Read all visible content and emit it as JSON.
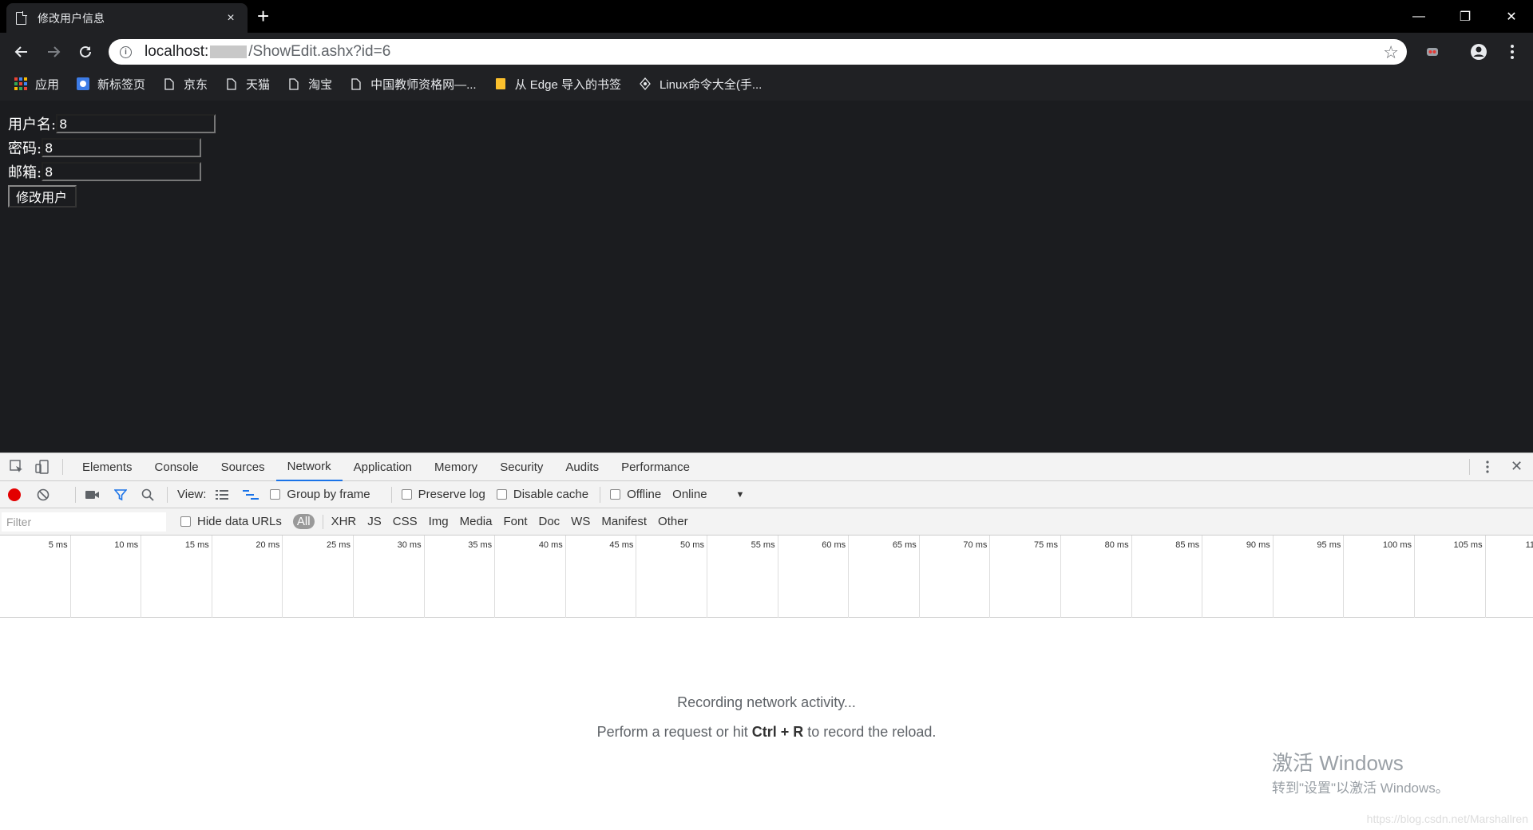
{
  "tab": {
    "title": "修改用户信息",
    "close_label": "×",
    "new_tab_label": "+"
  },
  "window": {
    "minimize": "—",
    "restore": "❐",
    "close": "✕"
  },
  "omnibox": {
    "host": "localhost:",
    "path": "/ShowEdit.ashx?id=6"
  },
  "bookmarks": [
    {
      "label": "应用",
      "icon": "apps-grid-icon"
    },
    {
      "label": "新标签页",
      "icon": "newtab-icon"
    },
    {
      "label": "京东",
      "icon": "page-icon"
    },
    {
      "label": "天猫",
      "icon": "page-icon"
    },
    {
      "label": "淘宝",
      "icon": "page-icon"
    },
    {
      "label": "中国教师资格网—...",
      "icon": "page-icon"
    },
    {
      "label": "从 Edge 导入的书签",
      "icon": "folder-icon"
    },
    {
      "label": "Linux命令大全(手...",
      "icon": "linux-icon"
    }
  ],
  "form": {
    "username_label": "用户名:",
    "username_value": "8",
    "password_label": "密码:",
    "password_value": "8",
    "email_label": "邮箱:",
    "email_value": "8",
    "submit_label": "修改用户"
  },
  "devtools": {
    "tabs": [
      "Elements",
      "Console",
      "Sources",
      "Network",
      "Application",
      "Memory",
      "Security",
      "Audits",
      "Performance"
    ],
    "active_tab": "Network",
    "controls": {
      "view_label": "View:",
      "group_by_frame": "Group by frame",
      "preserve_log": "Preserve log",
      "disable_cache": "Disable cache",
      "offline": "Offline",
      "throttle": "Online"
    },
    "filter": {
      "placeholder": "Filter",
      "hide_data_urls": "Hide data URLs",
      "types": [
        "All",
        "XHR",
        "JS",
        "CSS",
        "Img",
        "Media",
        "Font",
        "Doc",
        "WS",
        "Manifest",
        "Other"
      ]
    },
    "timeline_ticks": [
      "5 ms",
      "10 ms",
      "15 ms",
      "20 ms",
      "25 ms",
      "30 ms",
      "35 ms",
      "40 ms",
      "45 ms",
      "50 ms",
      "55 ms",
      "60 ms",
      "65 ms",
      "70 ms",
      "75 ms",
      "80 ms",
      "85 ms",
      "90 ms",
      "95 ms",
      "100 ms",
      "105 ms",
      "11"
    ],
    "empty": {
      "line1": "Recording network activity...",
      "line2_pre": "Perform a request or hit ",
      "line2_key": "Ctrl + R",
      "line2_post": " to record the reload."
    }
  },
  "watermark": {
    "title": "激活 Windows",
    "subtitle": "转到\"设置\"以激活 Windows。"
  },
  "credit": "https://blog.csdn.net/Marshallren",
  "colors": {
    "record": "#e30000",
    "active_tab_underline": "#1a73e8",
    "page_bg": "#1b1c1f"
  }
}
